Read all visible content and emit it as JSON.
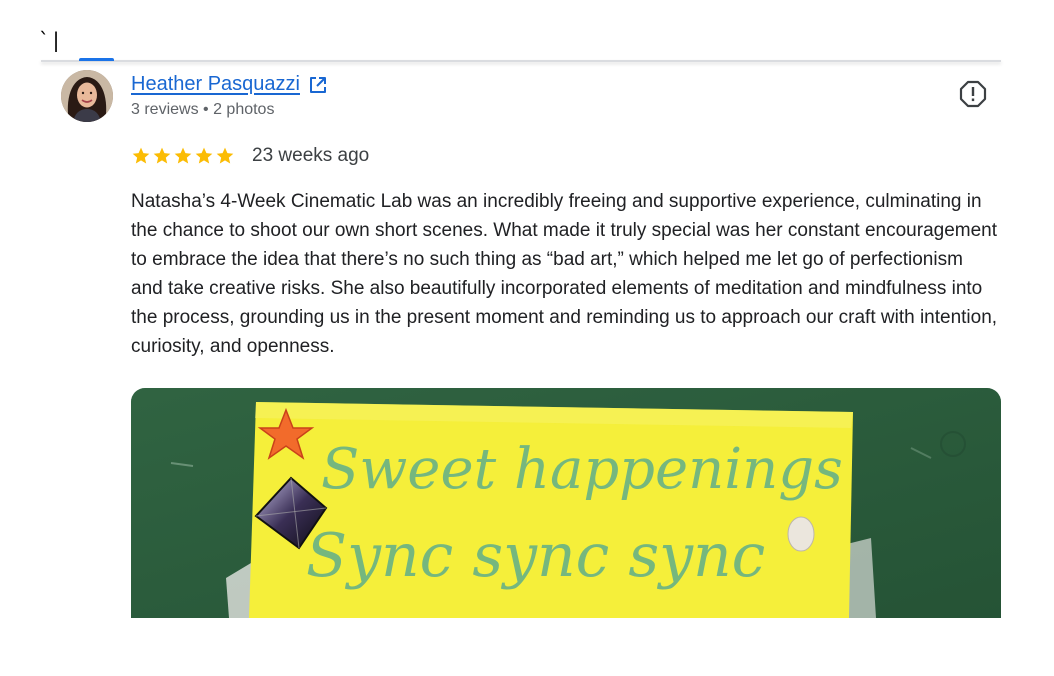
{
  "cursor_text": "`|",
  "reviewer": {
    "name": "Heather Pasquazzi",
    "meta": "3 reviews • 2 photos",
    "avatar_icon": "avatar-photo"
  },
  "review": {
    "rating": 5,
    "rating_max": 5,
    "time_ago": "23 weeks ago",
    "text": "Natasha’s 4-Week Cinematic Lab was an incredibly freeing and supportive experience, culminating in the chance to shoot our own short scenes. What made it truly special was her constant encouragement to embrace the idea that there’s no such thing as “bad art,” which helped me let go of perfectionism and take creative risks. She also beautifully incorporated elements of meditation and mindfulness into the process, grounding us in the present moment and reminding us to approach our craft with intention, curiosity, and openness."
  },
  "photo": {
    "note_line1": "Sweet happenings",
    "note_line2": "Sync sync sync"
  },
  "icons": {
    "open_external": "open-in-new-icon",
    "report": "report-icon",
    "star": "star-icon"
  },
  "colors": {
    "link": "#1967d2",
    "star": "#fbbc04",
    "tab_indicator": "#1a73e8",
    "note_yellow": "#f5ef3a",
    "board_green": "#2b5c3c"
  }
}
